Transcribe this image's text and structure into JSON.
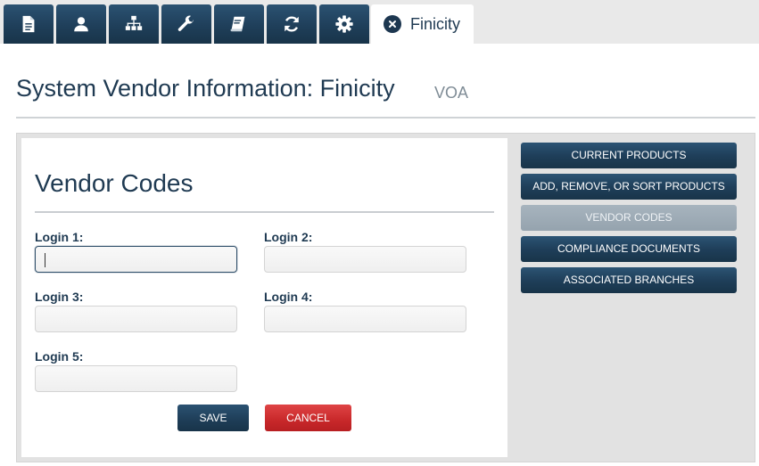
{
  "tabs": {
    "icons": [
      {
        "name": "document-icon"
      },
      {
        "name": "user-icon"
      },
      {
        "name": "org-chart-icon"
      },
      {
        "name": "wrench-icon"
      },
      {
        "name": "book-icon"
      },
      {
        "name": "refresh-icon"
      },
      {
        "name": "gear-icon"
      }
    ],
    "active_label": "Finicity",
    "active_icon": "close-icon"
  },
  "page": {
    "title": "System Vendor Information: Finicity",
    "subtitle": "VOA"
  },
  "form": {
    "section_title": "Vendor Codes",
    "fields": [
      {
        "label": "Login 1:",
        "value": ""
      },
      {
        "label": "Login 2:",
        "value": ""
      },
      {
        "label": "Login 3:",
        "value": ""
      },
      {
        "label": "Login 4:",
        "value": ""
      },
      {
        "label": "Login 5:",
        "value": ""
      }
    ],
    "save_label": "SAVE",
    "cancel_label": "CANCEL"
  },
  "side_nav": {
    "items": [
      {
        "label": "CURRENT PRODUCTS"
      },
      {
        "label": "ADD, REMOVE, OR SORT PRODUCTS"
      },
      {
        "label": "VENDOR CODES"
      },
      {
        "label": "COMPLIANCE DOCUMENTS"
      },
      {
        "label": "ASSOCIATED BRANCHES"
      }
    ],
    "active_item": "VENDOR CODES"
  },
  "colors": {
    "navy": "#1f3f5a",
    "active_nav": "#9eacb7",
    "cancel_red": "#c8282a",
    "panel_bg": "#e2e2e2"
  }
}
